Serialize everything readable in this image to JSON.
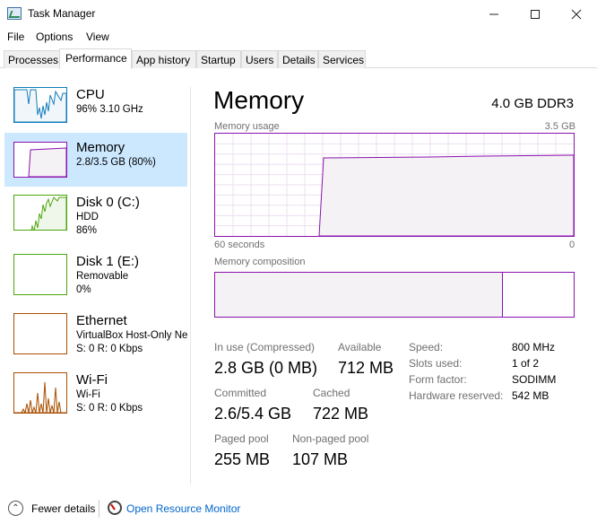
{
  "window": {
    "title": "Task Manager",
    "icon": "task-manager-icon",
    "controls": [
      "minimize-icon",
      "maximize-icon",
      "close-icon"
    ]
  },
  "menu": [
    "File",
    "Options",
    "View"
  ],
  "tabs": [
    "Processes",
    "Performance",
    "App history",
    "Startup",
    "Users",
    "Details",
    "Services"
  ],
  "active_tab": "Performance",
  "sidebar": [
    {
      "name": "CPU",
      "line1": "96%  3.10 GHz",
      "line2": "",
      "color": "#117dbb"
    },
    {
      "name": "Memory",
      "line1": "2.8/3.5 GB (80%)",
      "line2": "",
      "color": "#8b12ae",
      "selected": true
    },
    {
      "name": "Disk 0 (C:)",
      "line1": "HDD",
      "line2": "86%",
      "color": "#4da60c"
    },
    {
      "name": "Disk 1 (E:)",
      "line1": "Removable",
      "line2": "0%",
      "color": "#4da60c"
    },
    {
      "name": "Ethernet",
      "line1": "VirtualBox Host-Only Ne",
      "line2": "S: 0  R: 0 Kbps",
      "color": "#a74f01"
    },
    {
      "name": "Wi-Fi",
      "line1": "Wi-Fi",
      "line2": "S: 0  R: 0 Kbps",
      "color": "#a74f01"
    }
  ],
  "main": {
    "title": "Memory",
    "spec": "4.0 GB DDR3",
    "usage_label": "Memory usage",
    "usage_max": "3.5 GB",
    "time_left": "60 seconds",
    "time_right": "0",
    "usage_fraction": 0.8,
    "composition_label": "Memory composition",
    "composition_in_use_fraction": 0.8,
    "accent_color": "#8b12ae"
  },
  "stats": {
    "in_use_label": "In use (Compressed)",
    "in_use_value": "2.8 GB (0 MB)",
    "available_label": "Available",
    "available_value": "712 MB",
    "committed_label": "Committed",
    "committed_value": "2.6/5.4 GB",
    "cached_label": "Cached",
    "cached_value": "722 MB",
    "paged_label": "Paged pool",
    "paged_value": "255 MB",
    "nonpaged_label": "Non-paged pool",
    "nonpaged_value": "107 MB"
  },
  "specs": [
    {
      "k": "Speed:",
      "v": "800 MHz"
    },
    {
      "k": "Slots used:",
      "v": "1 of 2"
    },
    {
      "k": "Form factor:",
      "v": "SODIMM"
    },
    {
      "k": "Hardware reserved:",
      "v": "542 MB"
    }
  ],
  "footer": {
    "fewer_details": "Fewer details",
    "open_monitor": "Open Resource Monitor"
  }
}
